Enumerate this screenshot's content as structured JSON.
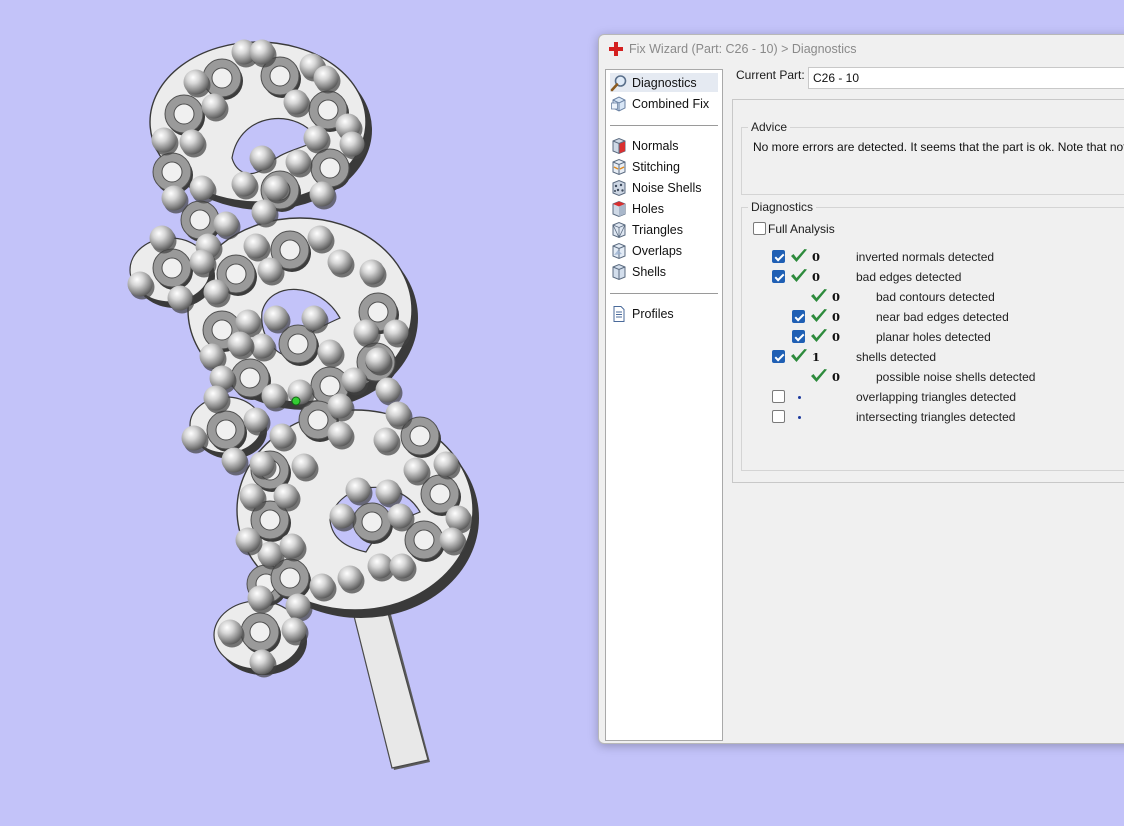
{
  "window": {
    "title": "Fix Wizard (Part: C26 - 10) > Diagnostics"
  },
  "nav": {
    "items": [
      {
        "label": "Diagnostics",
        "icon": "magnifier-icon",
        "selected": true
      },
      {
        "label": "Combined Fix",
        "icon": "combined-fix-icon"
      },
      {
        "label": "Normals",
        "icon": "normals-icon"
      },
      {
        "label": "Stitching",
        "icon": "stitching-icon"
      },
      {
        "label": "Noise Shells",
        "icon": "noise-shells-icon"
      },
      {
        "label": "Holes",
        "icon": "holes-icon"
      },
      {
        "label": "Triangles",
        "icon": "triangles-icon"
      },
      {
        "label": "Overlaps",
        "icon": "overlaps-icon"
      },
      {
        "label": "Shells",
        "icon": "shells-icon"
      },
      {
        "label": "Profiles",
        "icon": "profiles-icon"
      }
    ]
  },
  "current_part": {
    "label": "Current Part:",
    "value": "C26 - 10"
  },
  "advice": {
    "title": "Advice",
    "text": "No more errors are detected. It seems that the part is ok. Note that not all pa"
  },
  "diagnostics": {
    "title": "Diagnostics",
    "full_analysis_label": "Full Analysis",
    "full_analysis_checked": false,
    "rows": [
      {
        "checked": true,
        "status": "ok",
        "count": "0",
        "label": "inverted normals detected"
      },
      {
        "checked": true,
        "status": "ok",
        "count": "0",
        "label": "bad edges detected"
      },
      {
        "checked": null,
        "status": "ok",
        "count": "0",
        "label": "bad contours detected"
      },
      {
        "checked": true,
        "status": "ok",
        "count": "0",
        "label": "near bad edges detected"
      },
      {
        "checked": true,
        "status": "ok",
        "count": "0",
        "label": "planar holes detected"
      },
      {
        "checked": true,
        "status": "ok",
        "count": "1",
        "label": "shells detected"
      },
      {
        "checked": null,
        "status": "ok",
        "count": "0",
        "label": "possible noise shells detected"
      },
      {
        "checked": false,
        "status": "pending",
        "count": "",
        "label": "overlapping triangles detected"
      },
      {
        "checked": false,
        "status": "pending",
        "count": "",
        "label": "intersecting triangles detected"
      }
    ]
  },
  "colors": {
    "viewport_background": "#c3c3f9",
    "checkbox_accent": "#1f5fb4",
    "ok_tick": "#2e8b3d",
    "pending_dot": "#1d3a9e"
  }
}
